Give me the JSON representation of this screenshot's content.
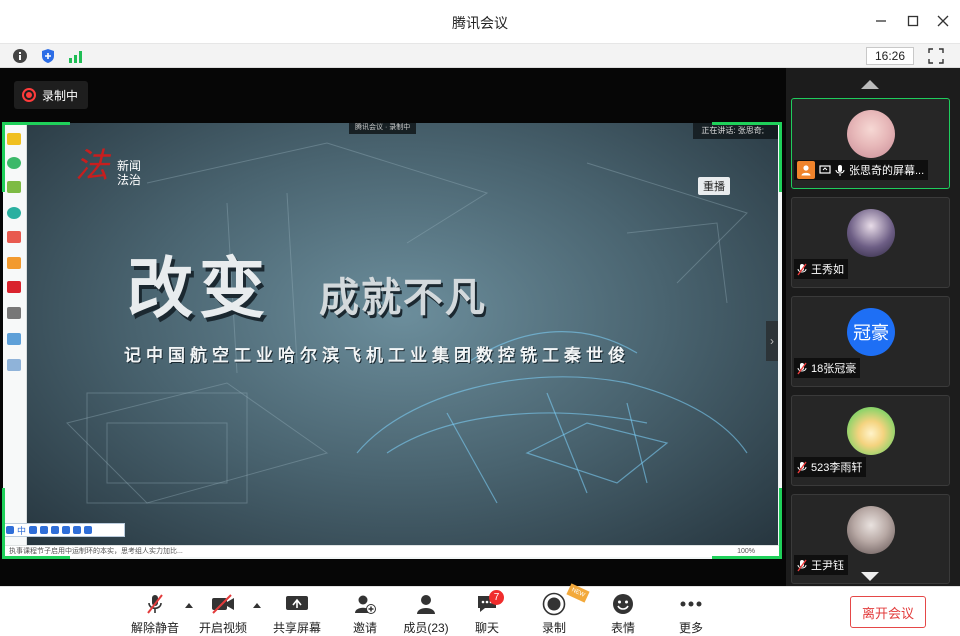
{
  "window": {
    "title": "腾讯会议"
  },
  "infobar": {
    "time": "16:26"
  },
  "recording": {
    "label": "录制中"
  },
  "shared_screen": {
    "meeting_tag": "腾讯会议 · 录制中",
    "speaking": "正在讲话: 张思奇;",
    "logo_text": "新闻法治",
    "rebroadcast": "重播",
    "headline_big": "改变",
    "headline_small": "成就不凡",
    "subline": "记中国航空工业哈尔滨飞机工业集团数控铣工秦世俊",
    "ime_label": "中",
    "status_text": "执事课程节子启用中运制环的本实，思考组人实力加比...",
    "zoom": "100%"
  },
  "participants": [
    {
      "name": "张思奇的屏幕...",
      "is_host": true
    },
    {
      "name": "王秀如",
      "is_host": false
    },
    {
      "name": "18张冠豪",
      "is_host": false,
      "avatar_text": "冠豪"
    },
    {
      "name": "523李雨轩",
      "is_host": false
    },
    {
      "name": "王尹钰",
      "is_host": false
    }
  ],
  "toolbar": {
    "unmute": "解除静音",
    "start_video": "开启视频",
    "share_screen": "共享屏幕",
    "invite": "邀请",
    "members": "成员(23)",
    "chat": "聊天",
    "chat_badge": "7",
    "record": "录制",
    "new_tag": "NEW",
    "emoji": "表情",
    "more": "更多",
    "leave": "离开会议"
  },
  "colors": {
    "accent_green": "#1fd05a",
    "leave_red": "#e23b3b",
    "host_orange": "#f0832b"
  }
}
